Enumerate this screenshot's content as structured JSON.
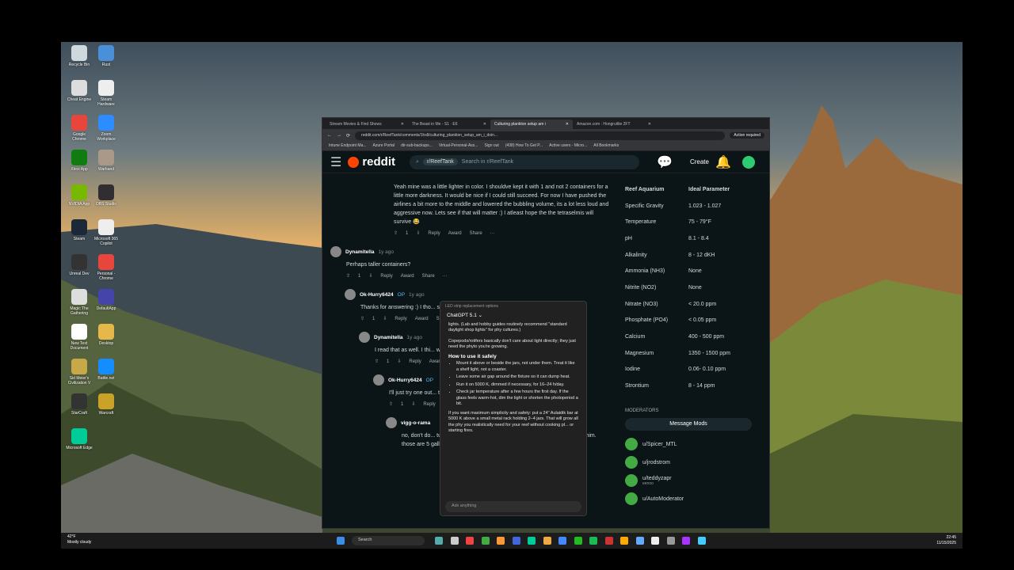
{
  "desktop": {
    "icons": [
      {
        "label": "Recycle Bin",
        "color": "#cfd8dc"
      },
      {
        "label": "Rust",
        "color": "#4a90d9"
      },
      {
        "label": "Cheat Engine",
        "color": "#ddd"
      },
      {
        "label": "Steam Hardware",
        "color": "#eee"
      },
      {
        "label": "Google Chrome",
        "color": "#e8453c"
      },
      {
        "label": "Zoom Workplace",
        "color": "#2d8cff"
      },
      {
        "label": "Xbox App",
        "color": "#107c10"
      },
      {
        "label": "Warband",
        "color": "#a98"
      },
      {
        "label": "NVIDIA App",
        "color": "#76b900"
      },
      {
        "label": "OBS Studio",
        "color": "#302e31"
      },
      {
        "label": "Steam",
        "color": "#1b2838"
      },
      {
        "label": "Microsoft 365 Copilot",
        "color": "#eee"
      },
      {
        "label": "Unreal Dev",
        "color": "#333"
      },
      {
        "label": "Personal - Chrome",
        "color": "#e8453c"
      },
      {
        "label": "Magic The Gathering",
        "color": "#ddd"
      },
      {
        "label": "DefaultApp",
        "color": "#44a"
      },
      {
        "label": "New Text Document",
        "color": "#fff"
      },
      {
        "label": "Desktop",
        "color": "#e6b84a"
      },
      {
        "label": "Sid Meier's Civilization V",
        "color": "#c8a94a"
      },
      {
        "label": "Battle.net",
        "color": "#148eff"
      },
      {
        "label": "StarCraft",
        "color": "#333"
      },
      {
        "label": "Warcraft",
        "color": "#c9a227"
      },
      {
        "label": "Microsoft Edge",
        "color": "#0c9"
      }
    ]
  },
  "browser": {
    "tabs": [
      {
        "label": "Stream Movies & Find Shows",
        "active": false
      },
      {
        "label": "The Beast in Me - S1 · E6",
        "active": false
      },
      {
        "label": "Culturing plankton setup am i",
        "active": true
      },
      {
        "label": "Amazon.com : Hongruilite 2FT",
        "active": false
      }
    ],
    "url": "reddit.com/r/ReefTank/comments/1hxll/culturing_plankton_setup_am_i_doin...",
    "action_required": "Action required",
    "bookmarks": [
      "Intune Endpoint Ma...",
      "Azure Portal",
      "dir-sub-backups...",
      "Virtual-Personal-Ass...",
      "Sign out",
      "(438) How To Get P...",
      "Active users - Micro...",
      "All Bookmarks"
    ]
  },
  "reddit": {
    "logo": "reddit",
    "subreddit_chip": "r/ReefTank",
    "search_placeholder": "Search in r/ReefTank",
    "create": "Create",
    "notif_count": "4",
    "comments": [
      {
        "text": "Yeah mine was a little lighter in color. I shouldve kept it with 1 and not 2 containers for a little more darkness. It would be nice if I could still succeed. For now I have pushed the airlines a bit more to the middle and lowered the bubbling volume, its a lot less loud and aggressive now. Lets see if that will matter :) I atleast hope the the tetraselmis will survive 😂",
        "votes": "1"
      },
      {
        "user": "Dynamitella",
        "time": "1y ago",
        "text": "Perhaps taller containers?",
        "votes": "1"
      },
      {
        "user": "Ok-Hurry6424",
        "op": "OP",
        "time": "1y ago",
        "text": "Thanks for answering :) I tho... something and that it will ac... alright, so I will go try that :)",
        "votes": "1"
      },
      {
        "user": "Dynamitella",
        "time": "1y ago",
        "text": "I read that as well. I thi... with the air pumps pull... I'm not an expert either.",
        "votes": "1"
      },
      {
        "user": "Ok-Hurry6424",
        "op": "OP",
        "text": "I'll just try one out... times before succ...",
        "votes": "1"
      },
      {
        "user": "vigg-o-rama",
        "text": "no, don't do... turbulent. wa... want big bu... (you can wat... carboys behind him. those are 5 gallon jugs, so in your little containers"
      }
    ],
    "actions": {
      "reply": "Reply",
      "award": "Award",
      "share": "Share",
      "more": "···"
    },
    "sidebar": {
      "header": [
        "Reef Aquarium",
        "Ideal Parameter"
      ],
      "rows": [
        [
          "Specific Gravity",
          "1.023 - 1.027"
        ],
        [
          "Temperature",
          "75 - 79°F"
        ],
        [
          "pH",
          "8.1 - 8.4"
        ],
        [
          "Alkalinity",
          "8 - 12 dKH"
        ],
        [
          "Ammonia (NH3)",
          "None"
        ],
        [
          "Nitrite (NO2)",
          "None"
        ],
        [
          "Nitrate (NO3)",
          "< 20.0 ppm"
        ],
        [
          "Phosphate (PO4)",
          "< 0.05 ppm"
        ],
        [
          "Calcium",
          "400 - 500 ppm"
        ],
        [
          "Magnesium",
          "1350 - 1500 ppm"
        ],
        [
          "Iodine",
          "0.06- 0.10 ppm"
        ],
        [
          "Strontium",
          "8 - 14 ppm"
        ]
      ],
      "moderators_title": "MODERATORS",
      "message_mods": "Message Mods",
      "mods": [
        {
          "name": "u/Spicer_MTL",
          "sub": ""
        },
        {
          "name": "u/jrodstrom",
          "sub": ""
        },
        {
          "name": "u/teddyzapr",
          "sub": "eenoo"
        },
        {
          "name": "u/AutoModerator",
          "sub": ""
        }
      ]
    }
  },
  "chatgpt": {
    "window_title": "LED strip replacement options",
    "model": "ChatGPT 5.1 ⌄",
    "intro": "lights. (Lab and hobby guides routinely recommend \"standard daylight shop lights\" for phy cultures.)",
    "para": "Copepods/rotifers basically don't care about light directly; they just need the phyto you're growing.",
    "heading": "How to use it safely",
    "bullets": [
      "Mount it above or beside the jars, not under them. Treat it like a shelf light, not a coaster.",
      "Leave some air gap around the fixture so it can dump heat.",
      "Run it on 5000 K, dimmed if necessary, for 16–24 h/day.",
      "Check jar temperature after a few hours the first day. If the glass feels warm-hot, dim the light or shorten the photoperiod a bit."
    ],
    "closing": "If you want maximum simplicity and safety: put a 24\" Aulaidik bar at 5000 K above a small metal rack holding 2–4 jars. That will grow all the phy you realistically need for your reef without cooking pl... or starting fires.",
    "input_placeholder": "Ask anything"
  },
  "taskbar": {
    "weather_temp": "42°F",
    "weather_desc": "Mostly cloudy",
    "search": "Search",
    "time": "22:45",
    "date": "11/15/2025"
  }
}
